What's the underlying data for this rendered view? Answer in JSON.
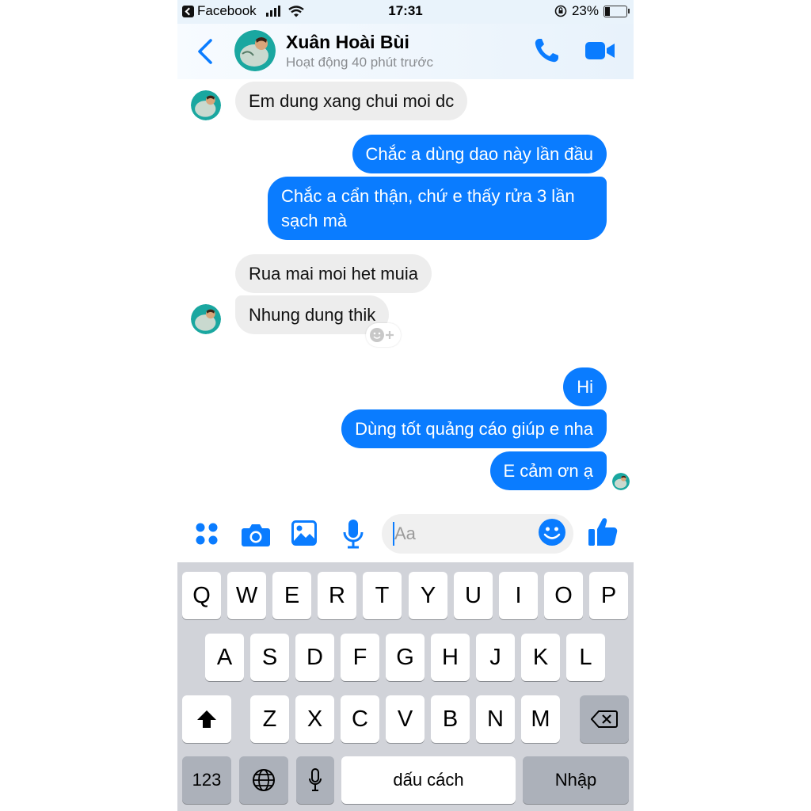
{
  "status_bar": {
    "back_app": "Facebook",
    "time": "17:31",
    "battery": "23%"
  },
  "header": {
    "contact_name": "Xuân Hoài Bùi",
    "contact_status": "Hoạt động 40 phút trước"
  },
  "messages": [
    {
      "side": "in",
      "text": "Em dung xang chui moi dc"
    },
    {
      "side": "out",
      "text": "Chắc a dùng dao này lần đầu"
    },
    {
      "side": "out",
      "text": "Chắc a cẩn thận, chứ e thấy rửa 3 lần sạch mà"
    },
    {
      "side": "in",
      "text": "Rua mai moi het muia"
    },
    {
      "side": "in",
      "text": "Nhung dung thik"
    },
    {
      "side": "out",
      "text": "Hi"
    },
    {
      "side": "out",
      "text": "Dùng tốt quảng cáo giúp e nha"
    },
    {
      "side": "out",
      "text": "E cảm ơn ạ"
    }
  ],
  "composer": {
    "placeholder": "Aa"
  },
  "keyboard": {
    "row1": [
      "Q",
      "W",
      "E",
      "R",
      "T",
      "Y",
      "U",
      "I",
      "O",
      "P"
    ],
    "row2": [
      "A",
      "S",
      "D",
      "F",
      "G",
      "H",
      "J",
      "K",
      "L"
    ],
    "row3": [
      "Z",
      "X",
      "C",
      "V",
      "B",
      "N",
      "M"
    ],
    "numbers_key": "123",
    "space_key": "dấu cách",
    "return_key": "Nhập"
  },
  "colors": {
    "accent": "#0a7cff",
    "incoming_bubble": "#ededed",
    "keyboard_bg": "#d1d3d9"
  }
}
